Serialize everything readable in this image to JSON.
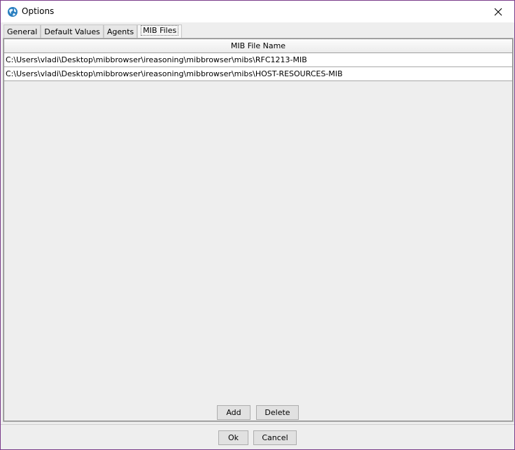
{
  "window": {
    "title": "Options",
    "icon": "globe-icon",
    "close_icon": "close-icon"
  },
  "tabs": [
    {
      "label": "General",
      "active": false
    },
    {
      "label": "Default Values",
      "active": false
    },
    {
      "label": "Agents",
      "active": false
    },
    {
      "label": "MIB Files",
      "active": true
    }
  ],
  "mib_table": {
    "header": "MIB File Name",
    "rows": [
      "C:\\Users\\vladi\\Desktop\\mibbrowser\\ireasoning\\mibbrowser\\mibs\\RFC1213-MIB",
      "C:\\Users\\vladi\\Desktop\\mibbrowser\\ireasoning\\mibbrowser\\mibs\\HOST-RESOURCES-MIB"
    ]
  },
  "panel_buttons": {
    "add": "Add",
    "delete": "Delete"
  },
  "dialog_buttons": {
    "ok": "Ok",
    "cancel": "Cancel"
  }
}
